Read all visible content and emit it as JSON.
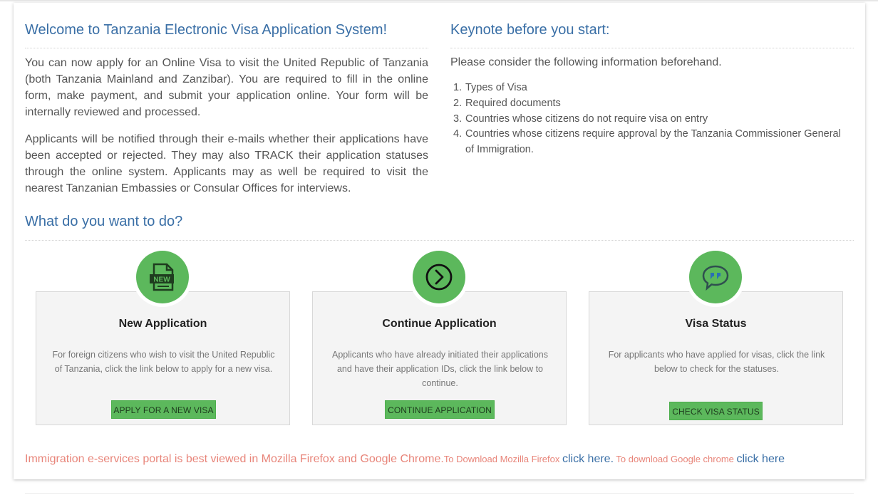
{
  "welcome": {
    "title": "Welcome to Tanzania Electronic Visa Application System!",
    "para1": "You can now apply for an Online Visa to visit the United Republic of Tanzania (both Tanzania Mainland and Zanzibar). You are required to fill in the online form, make payment, and submit your application online. Your form will be internally reviewed and processed.",
    "para2": "Applicants will be notified through their e-mails whether their applications have been accepted or rejected. They may also TRACK their application statuses through the online system. Applicants may as well be required to visit the nearest Tanzanian Embassies or Consular Offices for interviews."
  },
  "keynote": {
    "title": "Keynote before you start:",
    "intro": "Please consider the following information beforehand.",
    "items": [
      {
        "num": "1.",
        "text": "Types of Visa"
      },
      {
        "num": "2.",
        "text": "Required documents"
      },
      {
        "num": "3.",
        "text": "Countries whose citizens do not require visa on entry"
      },
      {
        "num": "4.",
        "text": "Countries whose citizens require approval by the Tanzania Commissioner General of Immigration."
      }
    ]
  },
  "actions": {
    "title": "What do you want to do?",
    "cards": [
      {
        "icon": "new-document-icon",
        "title": "New Application",
        "description": "For foreign citizens who wish to visit the United Republic of Tanzania, click the link below to apply for a new visa.",
        "button": "APPLY FOR A NEW VISA"
      },
      {
        "icon": "chevron-right-circle-icon",
        "title": "Continue Application",
        "description": "Applicants who have already initiated their applications and have their application IDs, click the link below to continue.",
        "button": "CONTINUE APPLICATION"
      },
      {
        "icon": "quote-bubble-icon",
        "title": "Visa Status",
        "description": "For applicants who have applied for visas, click the link below to check for the statuses.",
        "button": "CHECK VISA STATUS"
      }
    ]
  },
  "footer": {
    "note": "Immigration e-services portal is best viewed in Mozilla Firefox and Google Chrome.",
    "firefox_prefix": "To Download Mozilla Firefox ",
    "firefox_link": "click here.",
    "chrome_prefix": " To download Google chrome ",
    "chrome_link": "click here"
  },
  "colors": {
    "accent_blue": "#3a6fa6",
    "button_green": "#5cb85c",
    "note_red": "#e8857a"
  }
}
